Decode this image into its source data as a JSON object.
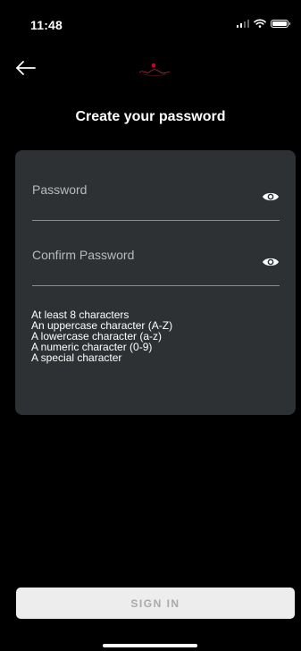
{
  "status_bar": {
    "time": "11:48"
  },
  "page": {
    "title": "Create your password"
  },
  "form": {
    "password": {
      "placeholder": "Password",
      "value": ""
    },
    "confirm_password": {
      "placeholder": "Confirm Password",
      "value": ""
    },
    "requirements": [
      "At least 8 characters",
      "An uppercase character (A-Z)",
      "A lowercase character (a-z)",
      "A numeric character (0-9)",
      "A special character"
    ]
  },
  "actions": {
    "sign_in_label": "SIGN IN"
  },
  "icons": {
    "back": "arrow-left-icon",
    "show_password": "eye-icon",
    "logo": "brand-logo"
  },
  "colors": {
    "background": "#000000",
    "card": "#2e3133",
    "button_background": "#ededed",
    "button_text": "#a9a9a9",
    "logo_accent": "#d0021b"
  }
}
